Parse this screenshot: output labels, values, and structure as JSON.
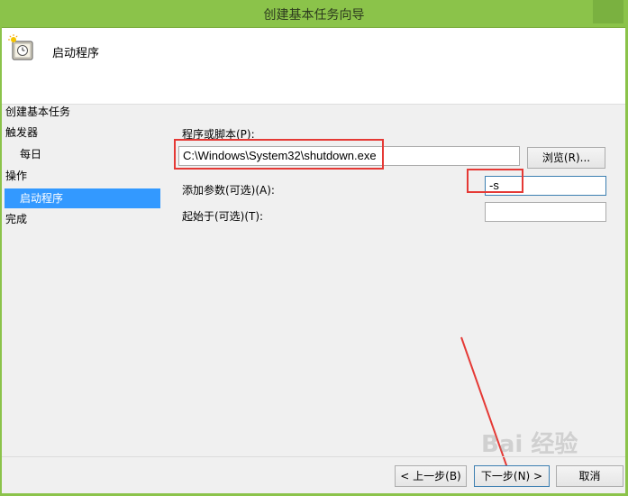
{
  "window": {
    "title": "创建基本任务向导"
  },
  "header": {
    "title": "启动程序"
  },
  "steps": {
    "create": "创建基本任务",
    "trigger": "触发器",
    "daily": "每日",
    "action": "操作",
    "start_program": "启动程序",
    "finish": "完成"
  },
  "form": {
    "program_label": "程序或脚本(P):",
    "program_value": "C:\\Windows\\System32\\shutdown.exe",
    "browse_label": "浏览(R)...",
    "args_label": "添加参数(可选)(A):",
    "args_value": "-s",
    "startin_label": "起始于(可选)(T):",
    "startin_value": ""
  },
  "buttons": {
    "back": "< 上一步(B)",
    "next": "下一步(N) >",
    "cancel": "取消"
  },
  "watermark": "Bai 经验",
  "colors": {
    "titlebar": "#8bc34a",
    "selected_step": "#3399ff",
    "annotation": "#e53935"
  }
}
